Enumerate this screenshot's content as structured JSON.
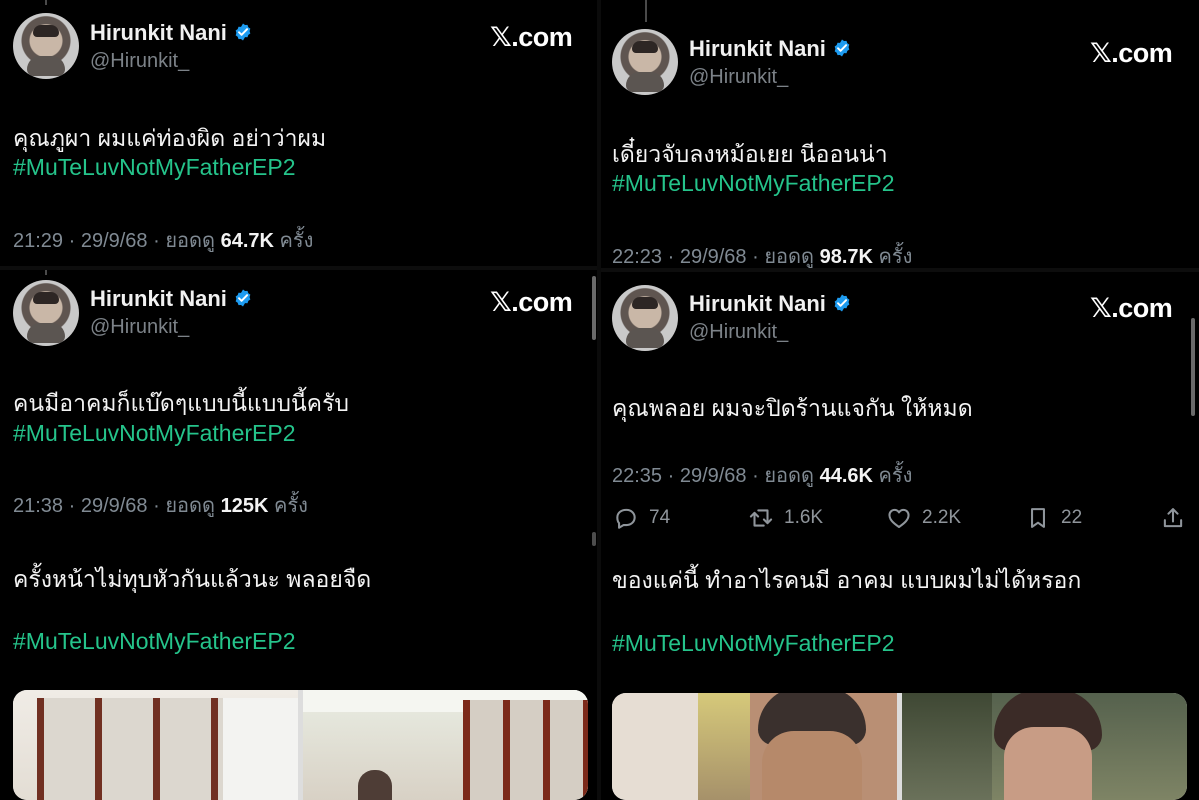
{
  "tweets": [
    {
      "name": "Hirunkit Nani",
      "handle": "@Hirunkit_",
      "source": "𝕏.com",
      "text": "คุณภูผา ผมแค่ท่องผิด อย่าว่าผม",
      "hashtag": "#MuTeLuvNotMyFatherEP2",
      "time": "21:29 · 29/9/68 · ยอดดู",
      "views": "64.7K",
      "views_unit": "ครั้ง"
    },
    {
      "name": "Hirunkit Nani",
      "handle": "@Hirunkit_",
      "source": "𝕏.com",
      "text": "เดี๋ยวจับลงหม้อเยย นีออนน่า",
      "hashtag": "#MuTeLuvNotMyFatherEP2",
      "time": "22:23 · 29/9/68 · ยอดดู",
      "views": "98.7K",
      "views_unit": "ครั้ง"
    },
    {
      "name": "Hirunkit Nani",
      "handle": "@Hirunkit_",
      "source": "𝕏.com",
      "text": "คนมีอาคมก็แบ๊ดๆแบบนี้แบบนี้ครับ",
      "hashtag": "#MuTeLuvNotMyFatherEP2",
      "time": "21:38 · 29/9/68 · ยอดดู",
      "views": "125K",
      "views_unit": "ครั้ง",
      "reply_text": "ครั้งหน้าไม่ทุบหัวกันแล้วนะ พลอยจืด",
      "reply_hashtag": "#MuTeLuvNotMyFatherEP2"
    },
    {
      "name": "Hirunkit Nani",
      "handle": "@Hirunkit_",
      "source": "𝕏.com",
      "text": "คุณพลอย ผมจะปิดร้านแจกัน ให้หมด",
      "time": "22:35 · 29/9/68 · ยอดดู",
      "views": "44.6K",
      "views_unit": "ครั้ง",
      "actions": {
        "replies": "74",
        "reposts": "1.6K",
        "likes": "2.2K",
        "bookmarks": "22"
      },
      "reply_text": "ของแค่นี้ ทำอาไรคนมี อาคม แบบผมไม่ได้หรอก",
      "reply_hashtag": "#MuTeLuvNotMyFatherEP2"
    }
  ],
  "icons": {
    "verified": "verified-badge-icon",
    "reply": "reply-icon",
    "repost": "repost-icon",
    "like": "heart-icon",
    "bookmark": "bookmark-icon",
    "share": "share-icon"
  },
  "colors": {
    "background": "#000000",
    "hashtag": "#25c48b",
    "verified": "#1d9bf0",
    "muted_text": "#808a93"
  }
}
